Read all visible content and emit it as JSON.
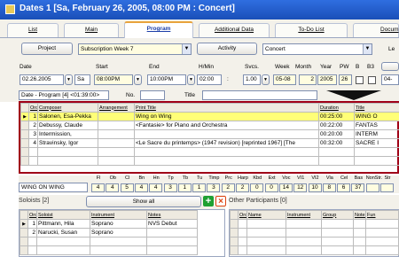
{
  "window": {
    "title": "Dates  1 [Sa, February 26, 2005, 08:00 PM : Concert]"
  },
  "tabs": [
    {
      "label": "List"
    },
    {
      "label": "Main"
    },
    {
      "label": "Program"
    },
    {
      "label": "Additional Data"
    },
    {
      "label": "To-Do List"
    },
    {
      "label": "Docum"
    }
  ],
  "toolbar": {
    "project_label": "Project",
    "project_value": "Subscription Week  7",
    "activity_label": "Activity",
    "activity_value": "Concert",
    "le_label": "Le"
  },
  "date_fields": {
    "headers": {
      "date": "Date",
      "start": "Start",
      "end": "End",
      "hmin": "H/Min",
      "svcs": "Svcs.",
      "week": "Week",
      "month": "Month",
      "year": "Year",
      "pw": "PW",
      "b": "B",
      "b3": "B3"
    },
    "date": "02.26.2005",
    "day": "Sa",
    "start": "08:00PM",
    "end": "10:00PM",
    "hmin": "02:00",
    "hmin_sep": ":",
    "svcs": "1.00",
    "week": "05-08",
    "month": "2",
    "year": "2005",
    "pw": "26",
    "tail": "04-"
  },
  "program_bar": {
    "label": "Date - Program  [4]  <01:39:00>",
    "no_label": "No.",
    "title_label": "Title"
  },
  "program": {
    "headers": [
      "Order",
      "Composer",
      "Arrangement",
      "Print Title",
      "Duration",
      "Title"
    ],
    "rows": [
      {
        "order": "1",
        "composer": "Salonen, Esa-Pekka",
        "arrangement": "",
        "print_title": "Wing on Wing",
        "duration": "00:25:00",
        "title": "WING O"
      },
      {
        "order": "2",
        "composer": "Debussy, Claude",
        "arrangement": "",
        "print_title": "<Fantasie> for Piano and Orchestra",
        "duration": "00:22:00",
        "title": "FANTAS"
      },
      {
        "order": "3",
        "composer": "Intermission,",
        "arrangement": "",
        "print_title": "",
        "duration": "00:20:00",
        "title": "INTERM"
      },
      {
        "order": "4",
        "composer": "Stravinsky, Igor",
        "arrangement": "",
        "print_title": "<Le Sacre du printemps> (1947 revision) [reprinted 1967] [The",
        "duration": "00:32:00",
        "title": "SACRE I"
      }
    ]
  },
  "instrumentation": {
    "title": "WING ON WING",
    "headers": [
      "Fl",
      "Ob",
      "Cl",
      "Bn",
      "Hn",
      "Tp",
      "Tb",
      "Tu",
      "Timp",
      "Prc",
      "Harp",
      "Kbd",
      "Ext",
      "Voc",
      "VI1",
      "VI2",
      "Vla",
      "Cel",
      "Bas",
      "NonStr.",
      "Str"
    ],
    "values": [
      "4",
      "4",
      "5",
      "4",
      "4",
      "3",
      "1",
      "1",
      "3",
      "2",
      "2",
      "0",
      "0",
      "14",
      "12",
      "10",
      "8",
      "6",
      "37",
      ""
    ]
  },
  "soloists": {
    "title": "Soloists  [2]",
    "show_all": "Show all",
    "headers": [
      "Order",
      "Soloist",
      "Instrument",
      "Notes"
    ],
    "rows": [
      {
        "order": "1",
        "soloist": "Pittmann, Hila",
        "instrument": "Soprano",
        "notes": "NVS Debut"
      },
      {
        "order": "2",
        "soloist": "Narucki, Susan",
        "instrument": "Soprano",
        "notes": ""
      }
    ]
  },
  "others": {
    "title": "Other Participants  [0]",
    "headers": [
      "Order",
      "Name",
      "Instrument",
      "Group",
      "Notes",
      "Fun"
    ]
  }
}
